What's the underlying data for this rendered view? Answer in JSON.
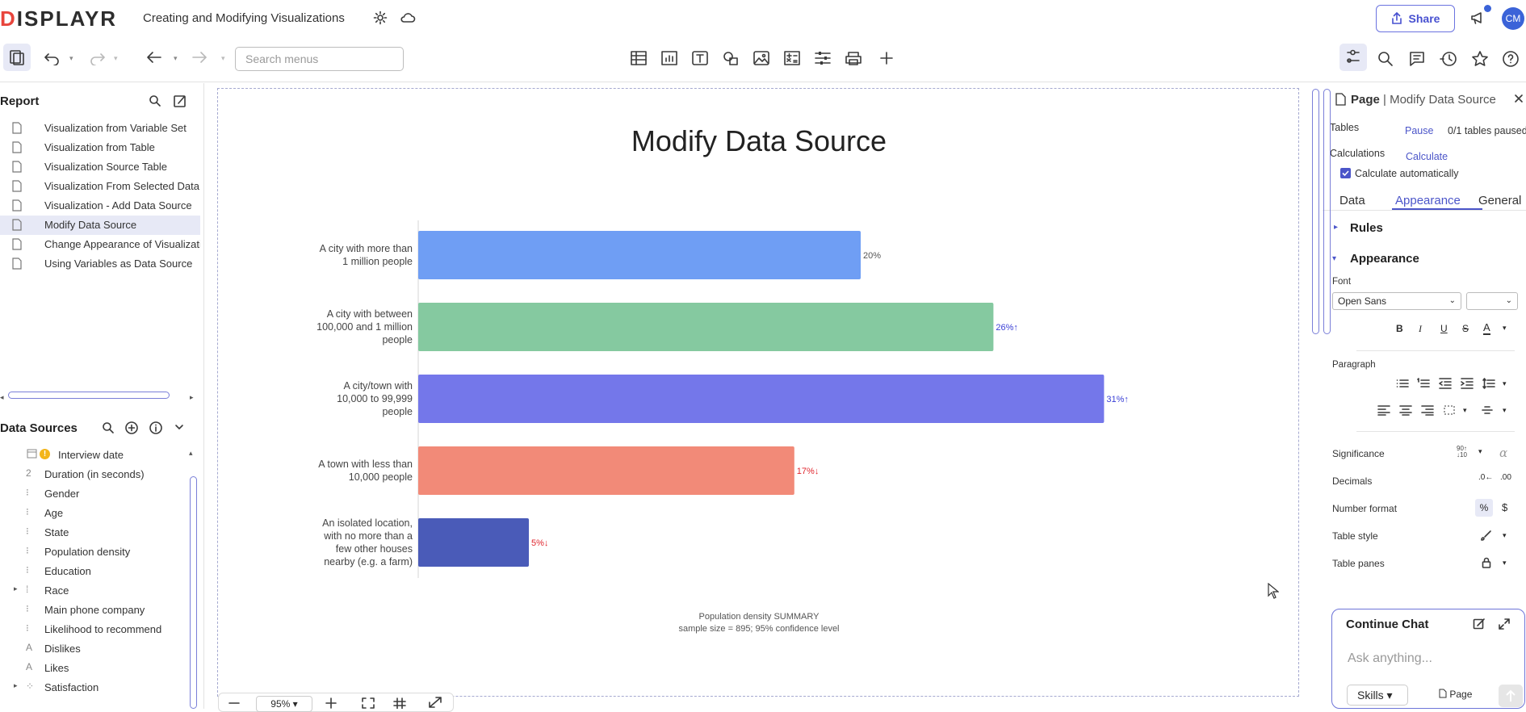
{
  "app": {
    "logo_prefix": "D",
    "logo_rest": "ISPLAYR",
    "document_title": "Creating and Modifying Visualizations",
    "share_label": "Share",
    "avatar_initials": "CM"
  },
  "toolbar": {
    "search_placeholder": "Search menus"
  },
  "report": {
    "header": "Report",
    "pages": [
      "Visualization from Variable Set",
      "Visualization from Table",
      "Visualization Source Table",
      "Visualization From Selected Data",
      "Visualization - Add Data Source",
      "Modify Data Source",
      "Change Appearance of Visualization",
      "Using Variables as Data Source"
    ],
    "selected_index": 5
  },
  "data_sources": {
    "header": "Data Sources",
    "items": [
      {
        "label": "Interview date",
        "icon": "calendar-icon"
      },
      {
        "label": "Duration (in seconds)",
        "icon": "numeric-icon"
      },
      {
        "label": "Gender",
        "icon": "categorical-icon"
      },
      {
        "label": "Age",
        "icon": "categorical-icon"
      },
      {
        "label": "State",
        "icon": "categorical-icon"
      },
      {
        "label": "Population density",
        "icon": "categorical-icon"
      },
      {
        "label": "Education",
        "icon": "categorical-icon"
      },
      {
        "label": "Race",
        "icon": "grid-icon"
      },
      {
        "label": "Main phone company",
        "icon": "categorical-icon"
      },
      {
        "label": "Likelihood to recommend",
        "icon": "categorical-icon"
      },
      {
        "label": "Dislikes",
        "icon": "text-icon"
      },
      {
        "label": "Likes",
        "icon": "text-icon"
      },
      {
        "label": "Satisfaction",
        "icon": "grid-icon"
      }
    ]
  },
  "chart_data": {
    "type": "bar",
    "orientation": "horizontal",
    "title": "Modify Data Source",
    "categories": [
      "A city with more than 1 million people",
      "A city with between 100,000 and 1 million people",
      "A city/town with 10,000 to 99,999 people",
      "A town with less than 10,000 people",
      "An isolated location, with no more than a few other houses nearby (e.g. a farm)"
    ],
    "category_lines": [
      [
        "A city with more than",
        "1 million people"
      ],
      [
        "A city with between",
        "100,000 and 1 million",
        "people"
      ],
      [
        "A city/town with",
        "10,000 to 99,999",
        "people"
      ],
      [
        "A town with less than",
        "10,000 people"
      ],
      [
        "An isolated location,",
        "with no more than a",
        "few other houses",
        "nearby (e.g. a farm)"
      ]
    ],
    "values": [
      20,
      26,
      31,
      17,
      5
    ],
    "data_labels": [
      "20%",
      "26%↑",
      "31%↑",
      "17%↓",
      "5%↓"
    ],
    "label_colors": [
      "#555555",
      "#3a3fd6",
      "#3a3fd6",
      "#e0262e",
      "#e0262e"
    ],
    "bar_colors": [
      "#6f9ef4",
      "#85c9a0",
      "#7477ea",
      "#f28a78",
      "#4a5bb8"
    ],
    "xlim": [
      0,
      32
    ],
    "footnote_line1": "Population density SUMMARY",
    "footnote_line2": "sample size = 895; 95% confidence level"
  },
  "zoom": {
    "level": "95%"
  },
  "right_panel": {
    "header_bold": "Page",
    "header_rest": "| Modify Data Source",
    "tables_label": "Tables",
    "tables_action": "Pause",
    "tables_status": "0/1 tables paused",
    "calculations_label": "Calculations",
    "calculations_action": "Calculate",
    "calc_auto_label": "Calculate automatically",
    "calc_auto_checked": true,
    "tabs": [
      "Data",
      "Appearance",
      "General"
    ],
    "active_tab": "Appearance",
    "rules_header": "Rules",
    "appearance_header": "Appearance",
    "font_label": "Font",
    "font_value": "Open Sans",
    "paragraph_label": "Paragraph",
    "rows": [
      "Significance",
      "Decimals",
      "Number format",
      "Table style",
      "Table panes"
    ],
    "chat_title": "Continue Chat",
    "chat_placeholder": "Ask anything...",
    "skills_label": "Skills",
    "page_chip": "Page"
  }
}
